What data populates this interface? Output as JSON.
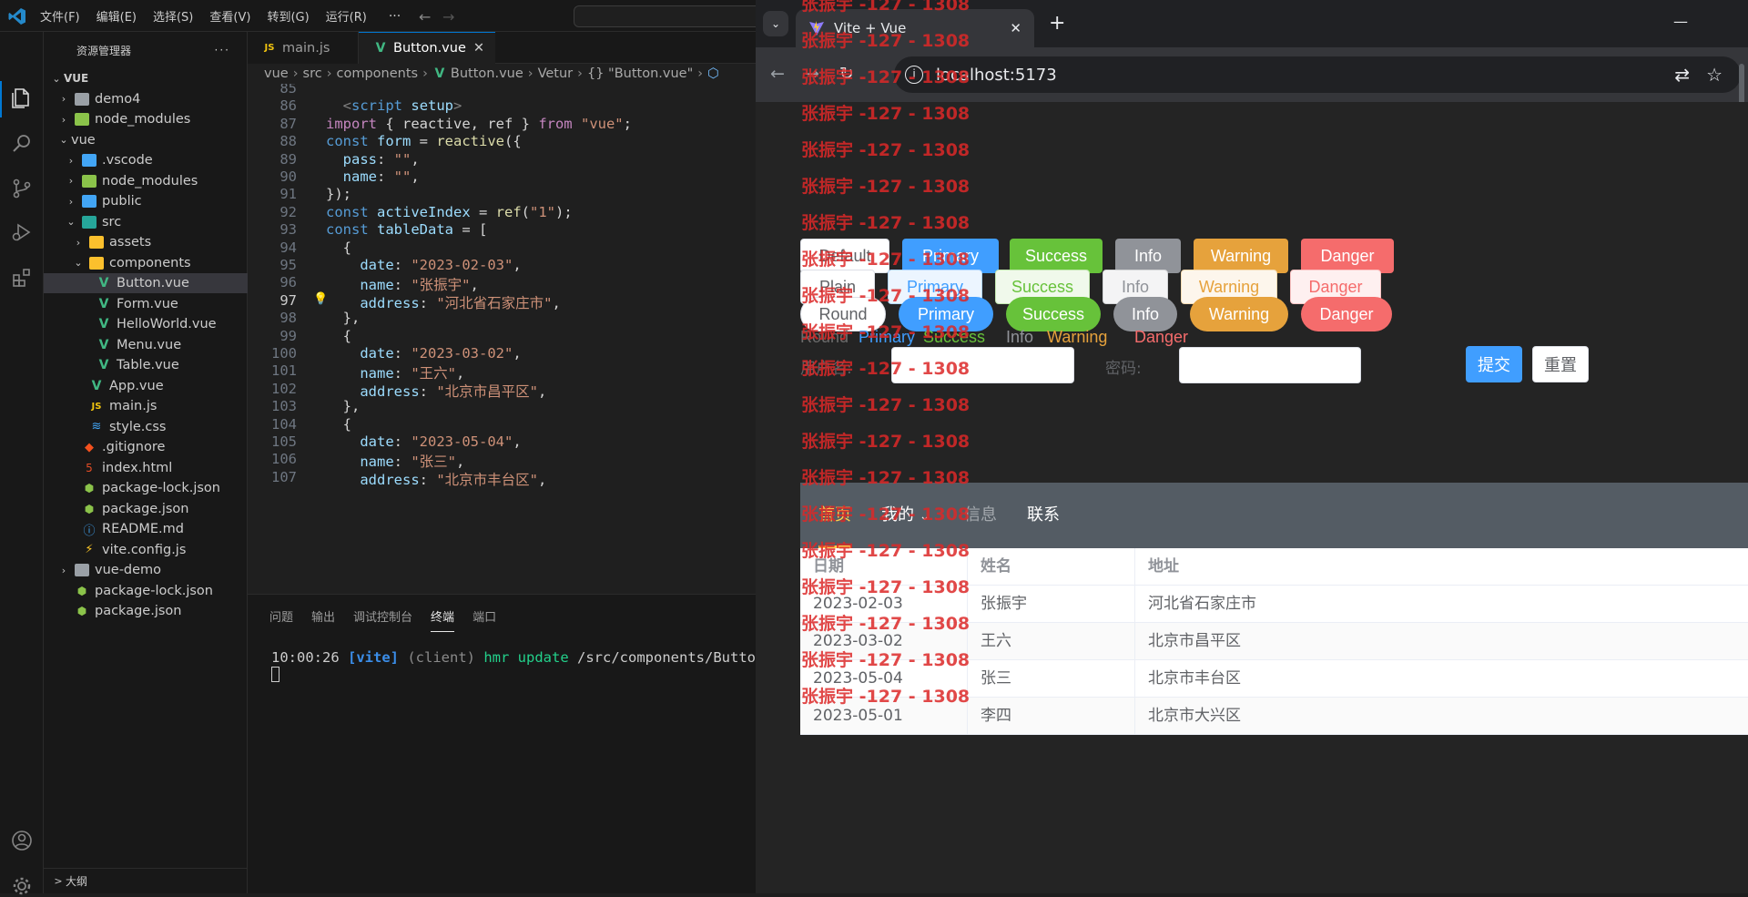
{
  "vscode": {
    "menu": [
      "文件(F)",
      "编辑(E)",
      "选择(S)",
      "查看(V)",
      "转到(G)",
      "运行(R)"
    ],
    "menu_more": "···",
    "explorer_title": "资源管理器",
    "explorer_more": "···",
    "tree": [
      {
        "label": "VUE",
        "indent": 0,
        "chev": "v",
        "icon": "none"
      },
      {
        "label": "demo4",
        "indent": 1,
        "chev": ">",
        "icon": "folder"
      },
      {
        "label": "node_modules",
        "indent": 1,
        "chev": ">",
        "icon": "folder-green"
      },
      {
        "label": "vue",
        "indent": 1,
        "chev": "v",
        "icon": "none"
      },
      {
        "label": ".vscode",
        "indent": 2,
        "chev": ">",
        "icon": "folder-blue"
      },
      {
        "label": "node_modules",
        "indent": 2,
        "chev": ">",
        "icon": "folder-green"
      },
      {
        "label": "public",
        "indent": 2,
        "chev": ">",
        "icon": "folder-blue"
      },
      {
        "label": "src",
        "indent": 2,
        "chev": "v",
        "icon": "folder-teal"
      },
      {
        "label": "assets",
        "indent": 3,
        "chev": ">",
        "icon": "folder-yellow"
      },
      {
        "label": "components",
        "indent": 3,
        "chev": "v",
        "icon": "folder-yellow"
      },
      {
        "label": "Button.vue",
        "indent": 4,
        "chev": "",
        "icon": "vue",
        "selected": true
      },
      {
        "label": "Form.vue",
        "indent": 4,
        "chev": "",
        "icon": "vue"
      },
      {
        "label": "HelloWorld.vue",
        "indent": 4,
        "chev": "",
        "icon": "vue"
      },
      {
        "label": "Menu.vue",
        "indent": 4,
        "chev": "",
        "icon": "vue"
      },
      {
        "label": "Table.vue",
        "indent": 4,
        "chev": "",
        "icon": "vue"
      },
      {
        "label": "App.vue",
        "indent": 3,
        "chev": "",
        "icon": "vue"
      },
      {
        "label": "main.js",
        "indent": 3,
        "chev": "",
        "icon": "js"
      },
      {
        "label": "style.css",
        "indent": 3,
        "chev": "",
        "icon": "css"
      },
      {
        "label": ".gitignore",
        "indent": 2,
        "chev": "",
        "icon": "git"
      },
      {
        "label": "index.html",
        "indent": 2,
        "chev": "",
        "icon": "html"
      },
      {
        "label": "package-lock.json",
        "indent": 2,
        "chev": "",
        "icon": "json"
      },
      {
        "label": "package.json",
        "indent": 2,
        "chev": "",
        "icon": "json"
      },
      {
        "label": "README.md",
        "indent": 2,
        "chev": "",
        "icon": "info"
      },
      {
        "label": "vite.config.js",
        "indent": 2,
        "chev": "",
        "icon": "vite"
      },
      {
        "label": "vue-demo",
        "indent": 1,
        "chev": ">",
        "icon": "folder"
      },
      {
        "label": "package-lock.json",
        "indent": 1,
        "chev": "",
        "icon": "json"
      },
      {
        "label": "package.json",
        "indent": 1,
        "chev": "",
        "icon": "json"
      }
    ],
    "outline_label": "大纲",
    "tabs": [
      {
        "label": "main.js",
        "icon": "JS",
        "active": false
      },
      {
        "label": "Button.vue",
        "icon": "V",
        "active": true
      }
    ],
    "breadcrumb": [
      "vue",
      "src",
      "components",
      "Button.vue",
      "Vetur",
      "{} \"Button.vue\""
    ],
    "code_lines": [
      {
        "n": "85",
        "text": ""
      },
      {
        "n": "86",
        "text": "  <script setup>"
      },
      {
        "n": "87",
        "text": "import { reactive, ref } from \"vue\";"
      },
      {
        "n": "88",
        "text": "const form = reactive({"
      },
      {
        "n": "89",
        "text": "  pass: \"\","
      },
      {
        "n": "90",
        "text": "  name: \"\","
      },
      {
        "n": "91",
        "text": "});"
      },
      {
        "n": "92",
        "text": "const activeIndex = ref(\"1\");"
      },
      {
        "n": "93",
        "text": "const tableData = ["
      },
      {
        "n": "94",
        "text": "  {"
      },
      {
        "n": "95",
        "text": "    date: \"2023-02-03\","
      },
      {
        "n": "96",
        "text": "    name: \"张振宇\","
      },
      {
        "n": "97",
        "text": "    address: \"河北省石家庄市\",",
        "current": true
      },
      {
        "n": "98",
        "text": "  },"
      },
      {
        "n": "99",
        "text": "  {"
      },
      {
        "n": "100",
        "text": "    date: \"2023-03-02\","
      },
      {
        "n": "101",
        "text": "    name: \"王六\","
      },
      {
        "n": "102",
        "text": "    address: \"北京市昌平区\","
      },
      {
        "n": "103",
        "text": "  },"
      },
      {
        "n": "104",
        "text": "  {"
      },
      {
        "n": "105",
        "text": "    date: \"2023-05-04\","
      },
      {
        "n": "106",
        "text": "    name: \"张三\","
      },
      {
        "n": "107",
        "text": "    address: \"北京市丰台区\","
      }
    ],
    "panel_tabs": [
      "问题",
      "输出",
      "调试控制台",
      "终端",
      "端口"
    ],
    "panel_active": "终端",
    "terminal": {
      "time": "10:00:26",
      "tag": "[vite]",
      "client": "(client)",
      "hmr": "hmr update",
      "path": "/src/components/Button."
    }
  },
  "chrome": {
    "tab_search": "⌄",
    "tab_title": "Vite + Vue",
    "tab_close": "✕",
    "new_tab": "+",
    "minimize": "—",
    "url": "localhost:5173"
  },
  "page": {
    "buttons_row1": [
      {
        "label": "Default",
        "type": "default"
      },
      {
        "label": "Primary",
        "type": "primary"
      },
      {
        "label": "Success",
        "type": "success"
      },
      {
        "label": "Info",
        "type": "info"
      },
      {
        "label": "Warning",
        "type": "warning"
      },
      {
        "label": "Danger",
        "type": "danger"
      }
    ],
    "buttons_row2": [
      {
        "label": "Plain",
        "type": "default"
      },
      {
        "label": "Primary",
        "type": "primary"
      },
      {
        "label": "Success",
        "type": "success"
      },
      {
        "label": "Info",
        "type": "info"
      },
      {
        "label": "Warning",
        "type": "warning"
      },
      {
        "label": "Danger",
        "type": "danger"
      }
    ],
    "buttons_row3": [
      {
        "label": "Round",
        "type": "default"
      },
      {
        "label": "Primary",
        "type": "primary"
      },
      {
        "label": "Success",
        "type": "success"
      },
      {
        "label": "Info",
        "type": "info"
      },
      {
        "label": "Warning",
        "type": "warning"
      },
      {
        "label": "Danger",
        "type": "danger"
      }
    ],
    "text_buttons": [
      {
        "label": "Round",
        "color": "#6b6b6b"
      },
      {
        "label": "Primary",
        "color": "#409eff"
      },
      {
        "label": "Success",
        "color": "#67c23a"
      },
      {
        "label": "Info",
        "color": "#909399"
      },
      {
        "label": "Warning",
        "color": "#e6a23c"
      },
      {
        "label": "Danger",
        "color": "#f56c6c"
      }
    ],
    "form": {
      "username_label": "用户名:",
      "password_label": "密码:",
      "username_value": "",
      "password_value": "",
      "submit": "提交",
      "reset": "重置"
    },
    "menu": {
      "items": [
        "首页",
        "我的",
        "信息",
        "联系"
      ],
      "active": "首页",
      "disabled": "信息",
      "dropdown_arrow": "⌄"
    },
    "table": {
      "headers": [
        "日期",
        "姓名",
        "地址"
      ],
      "rows": [
        [
          "2023-02-03",
          "张振宇",
          "河北省石家庄市"
        ],
        [
          "2023-03-02",
          "王六",
          "北京市昌平区"
        ],
        [
          "2023-05-04",
          "张三",
          "北京市丰台区"
        ],
        [
          "2023-05-01",
          "李四",
          "北京市大兴区"
        ]
      ]
    },
    "watermark": "张振宇 -127 - 1308",
    "colors": {
      "primary": "#409eff",
      "success": "#67c23a",
      "info": "#909399",
      "warning": "#e6a23c",
      "danger": "#f56c6c",
      "menu_bg": "#545c64",
      "menu_active": "#ffd04b"
    }
  }
}
